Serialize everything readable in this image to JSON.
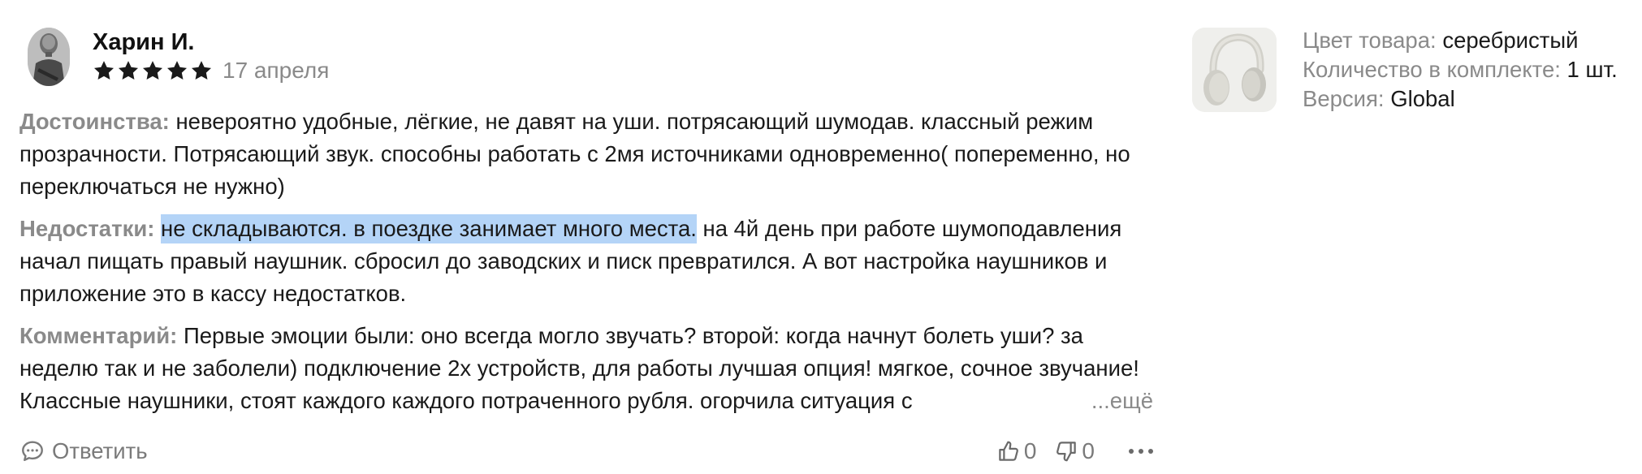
{
  "review": {
    "author": "Харин И.",
    "rating": 5,
    "max_rating": 5,
    "date": "17 апреля",
    "pros_label": "Достоинства:",
    "pros_text": "невероятно удобные, лёгкие, не давят на уши. потрясающий шумодав. классный режим прозрачности. Потрясающий звук. способны работать с 2мя источниками одновременно( попеременно, но переключаться не нужно)",
    "cons_label": "Недостатки:",
    "cons_highlighted": "не складываются. в поездке занимает много места.",
    "cons_text": "на 4й день при работе шумоподавления начал пищать правый наушник. сбросил до заводских и писк превратился. А вот настройка наушников и приложение это в кассу недостатков.",
    "comment_label": "Комментарий:",
    "comment_text": "Первые эмоции были: оно всегда могло звучать? второй: когда начнут болеть уши? за неделю так и не заболели) подключение 2х устройств, для работы лучшая опция! мягкое, сочное звучание! Классные наушники, стоят каждого каждого потраченного рубля. огорчила ситуация с",
    "more_label": "...ещё",
    "reply_label": "Ответить",
    "likes": "0",
    "dislikes": "0"
  },
  "product": {
    "attributes": [
      {
        "key": "Цвет товара:",
        "value": "серебристый"
      },
      {
        "key": "Количество в комплекте:",
        "value": "1 шт."
      },
      {
        "key": "Версия:",
        "value": "Global"
      }
    ]
  },
  "colors": {
    "star": "#1a1a1a",
    "highlight": "#b4d4f7",
    "muted": "#8a8a8a"
  },
  "icons": [
    "star-icon",
    "reply-bubble-icon",
    "thumbs-up-icon",
    "thumbs-down-icon",
    "more-dots-icon"
  ]
}
